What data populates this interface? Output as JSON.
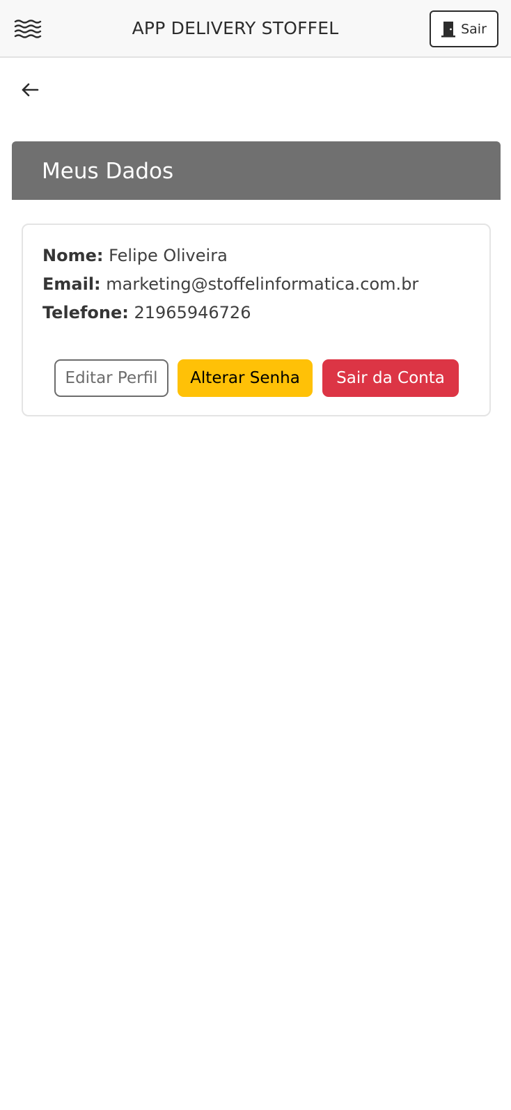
{
  "header": {
    "title": "APP DELIVERY STOFFEL",
    "logout_label": "Sair",
    "menu_icon": "waves-menu-icon",
    "logout_icon": "door-icon"
  },
  "nav": {
    "back_icon": "arrow-left-icon"
  },
  "section": {
    "title": "Meus Dados"
  },
  "profile": {
    "name_label": "Nome:",
    "name_value": "Felipe Oliveira",
    "email_label": "Email:",
    "email_value": "marketing@stoffelinformatica.com.br",
    "phone_label": "Telefone:",
    "phone_value": "21965946726"
  },
  "actions": {
    "edit_label": "Editar Perfil",
    "password_label": "Alterar Senha",
    "logout_label": "Sair da Conta"
  },
  "colors": {
    "header_bg": "#f8f8f8",
    "section_bg": "#707070",
    "warning": "#ffc107",
    "danger": "#dc3545",
    "secondary": "#6c6c6c"
  }
}
